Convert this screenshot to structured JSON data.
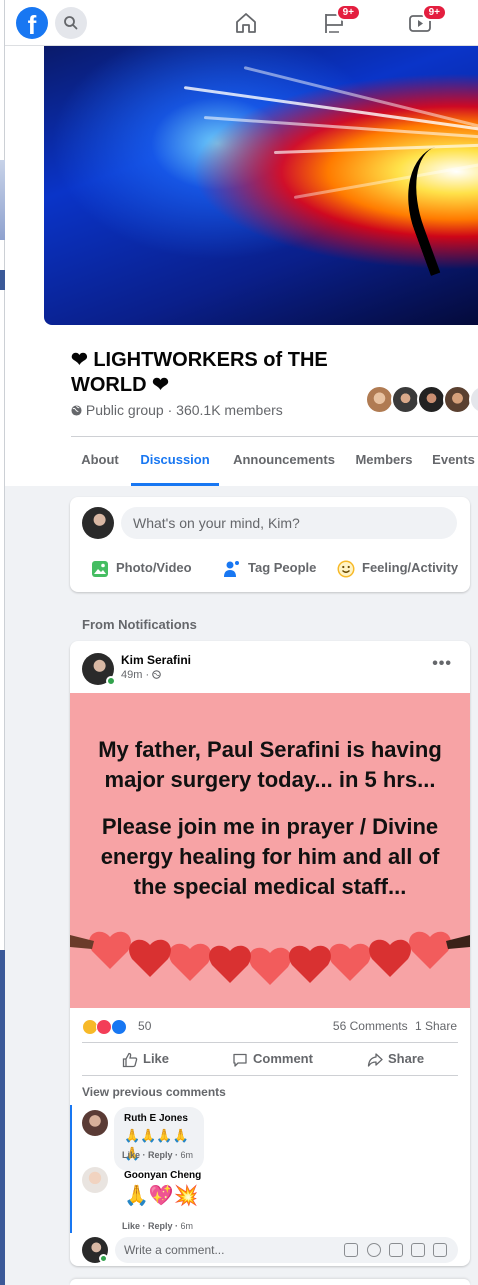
{
  "topbar": {
    "logo": "f",
    "notifications_badge": "9+",
    "watch_badge": "9+",
    "icons": [
      "facebook-logo-icon",
      "search-icon",
      "home-icon",
      "pages-flag-icon",
      "watch-video-icon"
    ]
  },
  "group": {
    "title": "❤ LIGHTWORKERS of THE WORLD ❤",
    "privacy_icon": "globe-icon",
    "meta": "Public group · 360.1K members"
  },
  "tabs": [
    {
      "label": "About",
      "active": false
    },
    {
      "label": "Discussion",
      "active": true
    },
    {
      "label": "Announcements",
      "active": false
    },
    {
      "label": "Members",
      "active": false
    },
    {
      "label": "Events",
      "active": false
    }
  ],
  "composer": {
    "placeholder": "What's on your mind, Kim?",
    "actions": [
      "Photo/Video",
      "Tag People",
      "Feeling/Activity"
    ]
  },
  "section_label": "From Notifications",
  "post": {
    "author": "Kim Serafini",
    "time": "49m · ",
    "more": "•••",
    "image_text_1": "My father, Paul Serafini is having major surgery today... in 5 hrs...",
    "image_text_2": "Please join me in prayer / Divine energy healing for him and all of the special medical staff...",
    "reaction_count": "50",
    "comments_count": "56 Comments",
    "shares_count": "1 Share",
    "like_label": "Like",
    "comment_label": "Comment",
    "share_label": "Share",
    "view_previous": "View previous comments"
  },
  "comments": [
    {
      "name": "Ruth E Jones",
      "text": "🙏🙏🙏🙏🙏",
      "like": "Like",
      "reply": "Reply",
      "time": "6m"
    },
    {
      "name": "Goonyan Cheng",
      "text": "🙏💖💥",
      "like": "Like",
      "reply": "Reply",
      "time": "6m"
    }
  ],
  "write_comment": {
    "placeholder": "Write a comment..."
  },
  "colors": {
    "accent": "#1877f2",
    "badge": "#e41e3f",
    "post_bg": "#f7a3a5",
    "heart_red": "#e23b3b"
  }
}
